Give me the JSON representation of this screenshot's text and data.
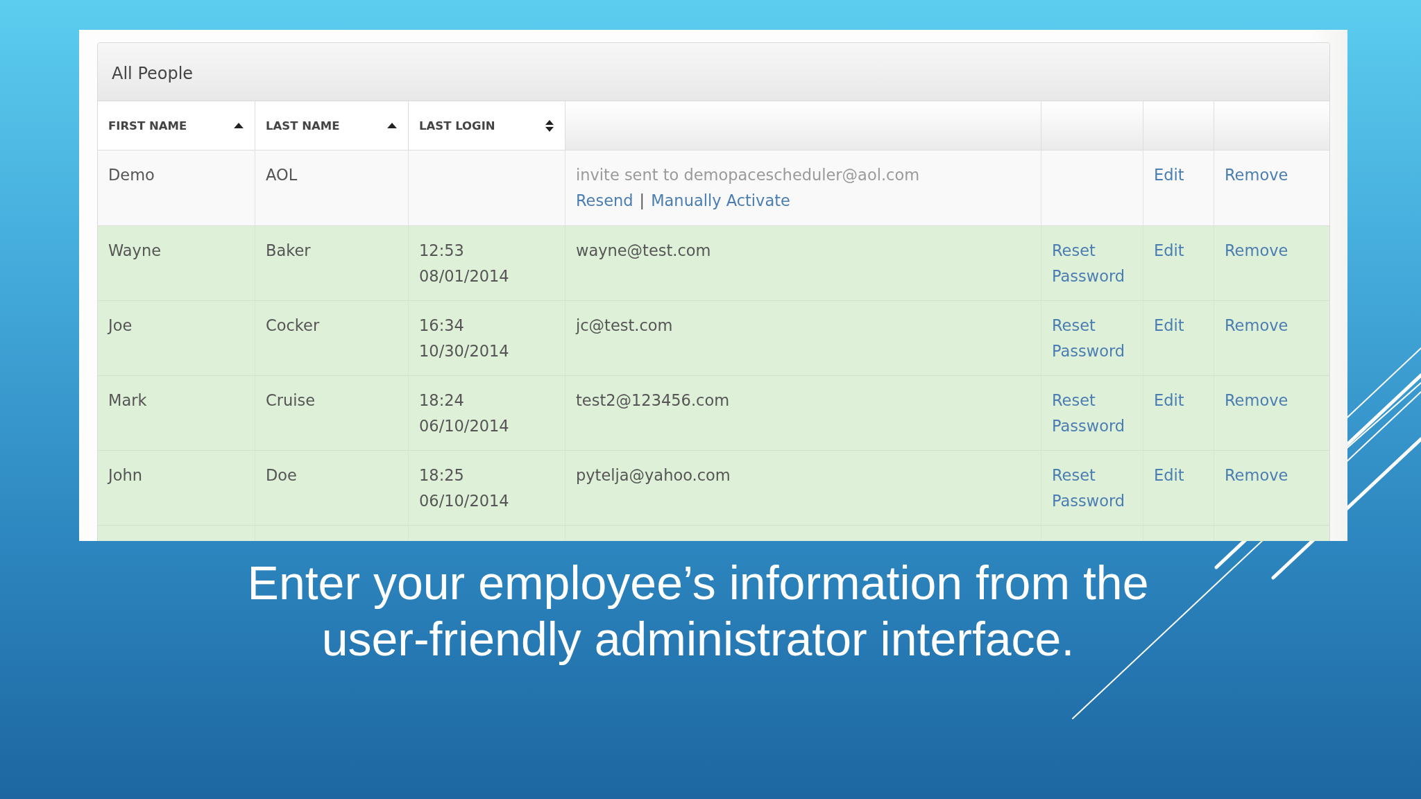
{
  "panel": {
    "title": "All People"
  },
  "table": {
    "columns": [
      {
        "label": "FIRST NAME",
        "sorted": true
      },
      {
        "label": "LAST NAME",
        "sorted": true
      },
      {
        "label": "LAST LOGIN",
        "sorted": false
      }
    ],
    "rows": [
      {
        "kind": "invited",
        "first_name": "Demo",
        "last_name": "AOL",
        "invite_note": "invite sent to demopacescheduler@aol.com",
        "invite_actions": [
          "Resend",
          "Manually Activate"
        ],
        "action_separator": "|",
        "edit": "Edit",
        "remove": "Remove"
      },
      {
        "kind": "active",
        "first_name": "Wayne",
        "last_name": "Baker",
        "last_login": "12:53 08/01/2014",
        "email": "wayne@test.com",
        "reset": "Reset Password",
        "edit": "Edit",
        "remove": "Remove"
      },
      {
        "kind": "active",
        "first_name": "Joe",
        "last_name": "Cocker",
        "last_login": "16:34 10/30/2014",
        "email": "jc@test.com",
        "reset": "Reset Password",
        "edit": "Edit",
        "remove": "Remove"
      },
      {
        "kind": "active",
        "first_name": "Mark",
        "last_name": "Cruise",
        "last_login": "18:24 06/10/2014",
        "email": "test2@123456.com",
        "reset": "Reset Password",
        "edit": "Edit",
        "remove": "Remove"
      },
      {
        "kind": "active",
        "first_name": "John",
        "last_name": "Doe",
        "last_login": "18:25 06/10/2014",
        "email": "pytelja@yahoo.com",
        "reset": "Reset Password",
        "edit": "Edit",
        "remove": "Remove"
      }
    ]
  },
  "caption": "Enter your employee’s information from the user-friendly administrator interface."
}
